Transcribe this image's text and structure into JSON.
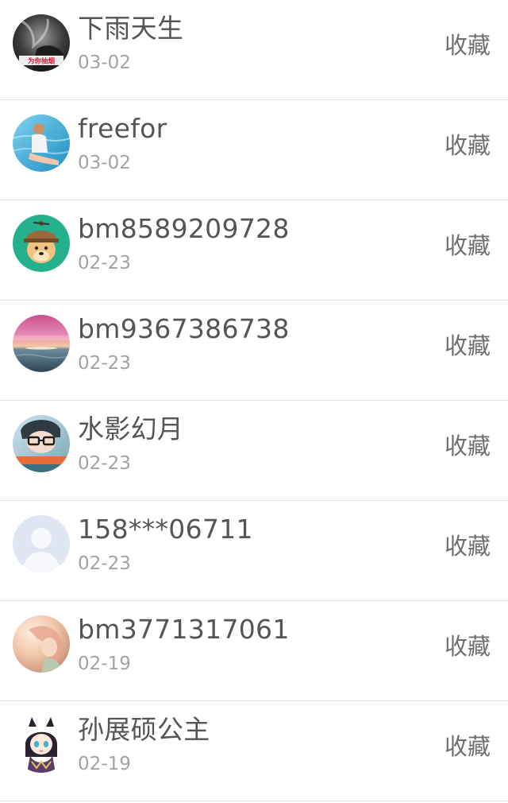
{
  "favorites": {
    "items": [
      {
        "name": "下雨天生",
        "date": "03-02",
        "action": "收藏",
        "avatar_text": "为你抽烟",
        "avatar_icon": "smoking-portrait-avatar"
      },
      {
        "name": "freefor",
        "date": "03-02",
        "action": "收藏",
        "avatar_icon": "pool-photo-avatar"
      },
      {
        "name": "bm8589209728",
        "date": "02-23",
        "action": "收藏",
        "avatar_icon": "doge-helmet-avatar"
      },
      {
        "name": "bm9367386738",
        "date": "02-23",
        "action": "收藏",
        "avatar_icon": "sunset-sea-avatar"
      },
      {
        "name": "水影幻月",
        "date": "02-23",
        "action": "收藏",
        "avatar_icon": "glasses-boy-avatar"
      },
      {
        "name": "158***06711",
        "date": "02-23",
        "action": "收藏",
        "avatar_icon": "default-user-avatar"
      },
      {
        "name": "bm3771317061",
        "date": "02-19",
        "action": "收藏",
        "avatar_icon": "soft-illustration-avatar"
      },
      {
        "name": "孙展硕公主",
        "date": "02-19",
        "action": "收藏",
        "avatar_icon": "anime-girl-avatar"
      }
    ]
  },
  "colors": {
    "name_text": "#555555",
    "date_text": "#a3a3a3",
    "action_text": "#6f6f6f",
    "divider": "#e3e3e3",
    "default_avatar_bg": "#dfe5f1",
    "default_avatar_figure": "#f6f8fc"
  }
}
